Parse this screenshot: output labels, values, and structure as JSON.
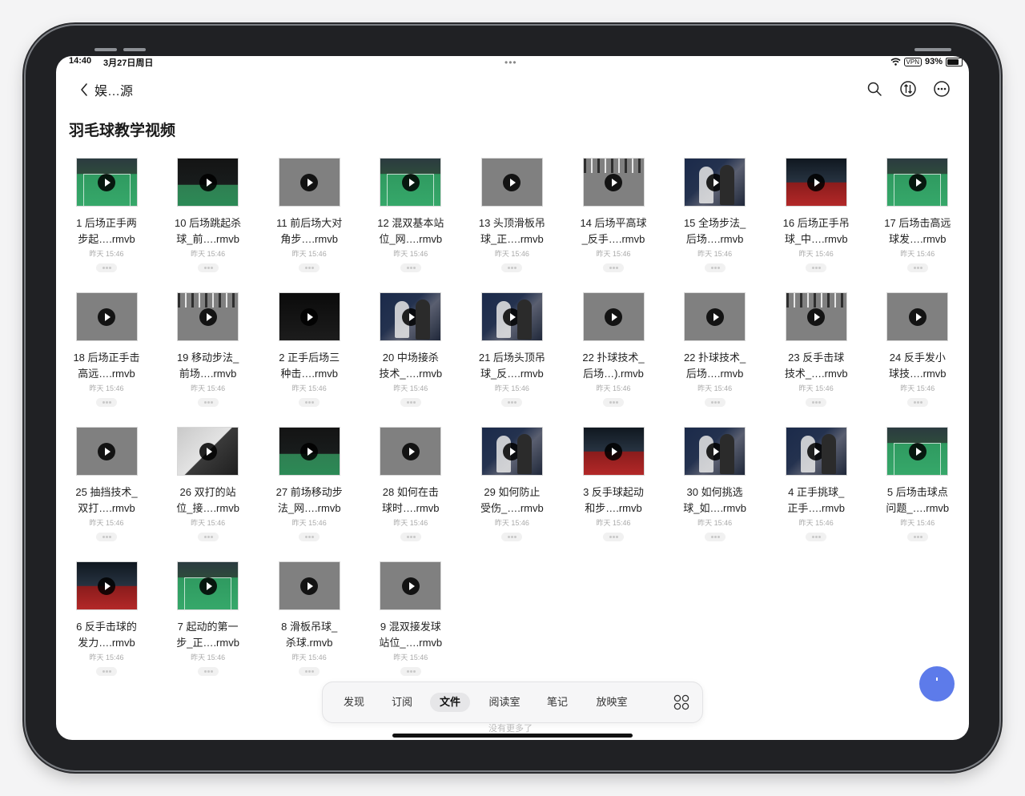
{
  "status_bar": {
    "time": "14:40",
    "date": "3月27日周日",
    "vpn": "VPN",
    "battery": "93%",
    "battery_level": 0.93
  },
  "header": {
    "back_title": "娱…源",
    "icons": [
      "search-icon",
      "sort-icon",
      "more-icon"
    ]
  },
  "folder": {
    "title": "羽毛球教学视频"
  },
  "files": [
    {
      "name_line1": "1 后场正手两",
      "name_line2": "步起….rmvb",
      "time": "昨天 15:46",
      "thumb": "court"
    },
    {
      "name_line1": "10 后场跳起杀",
      "name_line2": "球_前….rmvb",
      "time": "昨天 15:46",
      "thumb": "darkcourt"
    },
    {
      "name_line1": "11 前后场大对",
      "name_line2": "角步….rmvb",
      "time": "昨天 15:46",
      "thumb": "gray"
    },
    {
      "name_line1": "12 混双基本站",
      "name_line2": "位_网….rmvb",
      "time": "昨天 15:46",
      "thumb": "court"
    },
    {
      "name_line1": "13 头顶滑板吊",
      "name_line2": "球_正….rmvb",
      "time": "昨天 15:46",
      "thumb": "gray"
    },
    {
      "name_line1": "14 后场平高球",
      "name_line2": "_反手….rmvb",
      "time": "昨天 15:46",
      "thumb": "noise"
    },
    {
      "name_line1": "15 全场步法_",
      "name_line2": "后场….rmvb",
      "time": "昨天 15:46",
      "thumb": "people"
    },
    {
      "name_line1": "16 后场正手吊",
      "name_line2": "球_中….rmvb",
      "time": "昨天 15:46",
      "thumb": "red"
    },
    {
      "name_line1": "17 后场击高远",
      "name_line2": "球发….rmvb",
      "time": "昨天 15:46",
      "thumb": "court"
    },
    {
      "name_line1": "18 后场正手击",
      "name_line2": "高远….rmvb",
      "time": "昨天 15:46",
      "thumb": "gray"
    },
    {
      "name_line1": "19 移动步法_",
      "name_line2": "前场….rmvb",
      "time": "昨天 15:46",
      "thumb": "noise"
    },
    {
      "name_line1": "2 正手后场三",
      "name_line2": "种击….rmvb",
      "time": "昨天 15:46",
      "thumb": "dark"
    },
    {
      "name_line1": "20 中场接杀",
      "name_line2": "技术_….rmvb",
      "time": "昨天 15:46",
      "thumb": "people"
    },
    {
      "name_line1": "21 后场头顶吊",
      "name_line2": "球_反….rmvb",
      "time": "昨天 15:46",
      "thumb": "people"
    },
    {
      "name_line1": "22 扑球技术_",
      "name_line2": "后场…).rmvb",
      "time": "昨天 15:46",
      "thumb": "gray"
    },
    {
      "name_line1": "22 扑球技术_",
      "name_line2": "后场….rmvb",
      "time": "昨天 15:46",
      "thumb": "gray"
    },
    {
      "name_line1": "23 反手击球",
      "name_line2": "技术_….rmvb",
      "time": "昨天 15:46",
      "thumb": "noise"
    },
    {
      "name_line1": "24 反手发小",
      "name_line2": "球技….rmvb",
      "time": "昨天 15:46",
      "thumb": "gray"
    },
    {
      "name_line1": "25 抽挡技术_",
      "name_line2": "双打….rmvb",
      "time": "昨天 15:46",
      "thumb": "gray"
    },
    {
      "name_line1": "26 双打的站",
      "name_line2": "位_接….rmvb",
      "time": "昨天 15:46",
      "thumb": "hands"
    },
    {
      "name_line1": "27 前场移动步",
      "name_line2": "法_网….rmvb",
      "time": "昨天 15:46",
      "thumb": "darkcourt"
    },
    {
      "name_line1": "28 如何在击",
      "name_line2": "球时….rmvb",
      "time": "昨天 15:46",
      "thumb": "gray"
    },
    {
      "name_line1": "29 如何防止",
      "name_line2": "受伤_….rmvb",
      "time": "昨天 15:46",
      "thumb": "people"
    },
    {
      "name_line1": "3 反手球起动",
      "name_line2": "和步….rmvb",
      "time": "昨天 15:46",
      "thumb": "red"
    },
    {
      "name_line1": "30 如何挑选",
      "name_line2": "球_如….rmvb",
      "time": "昨天 15:46",
      "thumb": "people"
    },
    {
      "name_line1": "4 正手挑球_",
      "name_line2": "正手….rmvb",
      "time": "昨天 15:46",
      "thumb": "people"
    },
    {
      "name_line1": "5 后场击球点",
      "name_line2": "问题_….rmvb",
      "time": "昨天 15:46",
      "thumb": "court"
    },
    {
      "name_line1": "6 反手击球的",
      "name_line2": "发力….rmvb",
      "time": "昨天 15:46",
      "thumb": "red"
    },
    {
      "name_line1": "7 起动的第一",
      "name_line2": "步_正….rmvb",
      "time": "昨天 15:46",
      "thumb": "court"
    },
    {
      "name_line1": "8 滑板吊球_",
      "name_line2": "杀球.rmvb",
      "time": "昨天 15:46",
      "thumb": "gray"
    },
    {
      "name_line1": "9 混双接发球",
      "name_line2": "站位_….rmvb",
      "time": "昨天 15:46",
      "thumb": "gray"
    }
  ],
  "tabbar": {
    "tabs": [
      {
        "label": "发现",
        "active": false
      },
      {
        "label": "订阅",
        "active": false
      },
      {
        "label": "文件",
        "active": true
      },
      {
        "label": "阅读室",
        "active": false
      },
      {
        "label": "笔记",
        "active": false
      },
      {
        "label": "放映室",
        "active": false
      }
    ],
    "grid_icon": "apps-grid-icon"
  },
  "footer": {
    "no_more": "没有更多了"
  },
  "colors": {
    "accent": "#5d7bea",
    "device_frame": "#202124"
  }
}
